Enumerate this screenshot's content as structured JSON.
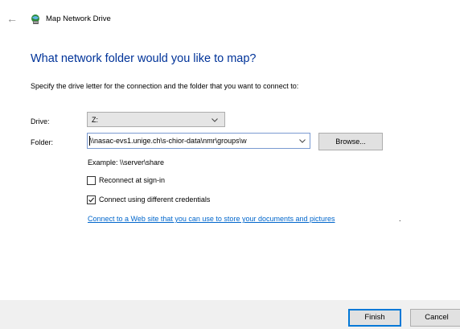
{
  "window": {
    "title": "Map Network Drive",
    "icons": {
      "back": "back-arrow-icon",
      "app": "network-drive-icon"
    }
  },
  "page": {
    "heading": "What network folder would you like to map?",
    "instruction": "Specify the drive letter for the connection and the folder that you want to connect to:"
  },
  "form": {
    "drive": {
      "label": "Drive:",
      "value": "Z:"
    },
    "folder": {
      "label": "Folder:",
      "value": "\\\\nasac-evs1.unige.ch\\s-chior-data\\nmr\\groups\\w"
    },
    "browse_label": "Browse...",
    "example": "Example: \\\\server\\share",
    "reconnect": {
      "label": "Reconnect at sign-in",
      "checked": false
    },
    "credentials": {
      "label": "Connect using different credentials",
      "checked": true
    },
    "link": {
      "text": "Connect to a Web site that you can use to store your documents and pictures",
      "trailing": "."
    }
  },
  "footer": {
    "finish_label": "Finish",
    "cancel_label": "Cancel"
  },
  "colors": {
    "heading": "#003399",
    "link": "#0066cc",
    "accent": "#0078d7",
    "footer_bg": "#f0f0f0"
  }
}
